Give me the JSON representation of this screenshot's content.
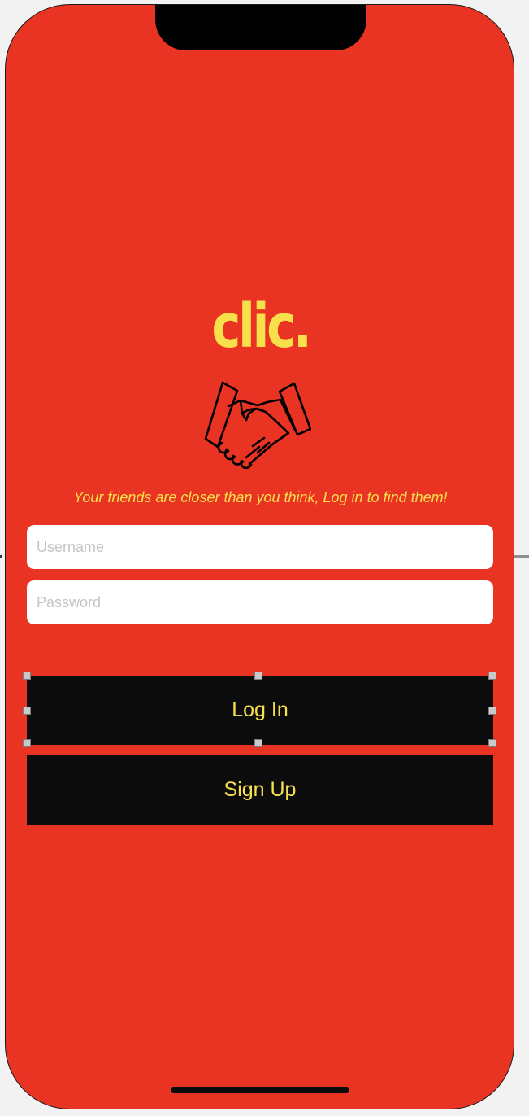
{
  "app": {
    "logo": "clic.",
    "tagline": "Your friends are closer than you think, Log in to find them!"
  },
  "form": {
    "username_placeholder": "Username",
    "password_placeholder": "Password"
  },
  "buttons": {
    "login_label": "Log In",
    "signup_label": "Sign Up"
  },
  "icons": {
    "illustration": "handshake-icon"
  },
  "colors": {
    "background": "#e93323",
    "accent": "#f8e04b",
    "button": "#0c0c0c"
  }
}
